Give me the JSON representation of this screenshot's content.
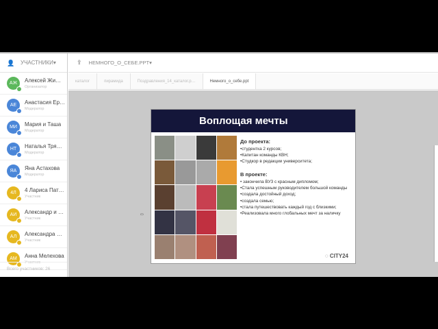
{
  "sidebar": {
    "title": "УЧАСТНИКИ",
    "participants": [
      {
        "initials": "АЖ",
        "name": "Алексей Жи…",
        "role": "Организатор",
        "color": "#5cb85c"
      },
      {
        "initials": "АЕ",
        "name": "Анастасия Ер…",
        "role": "Модератор",
        "color": "#4a86d8"
      },
      {
        "initials": "МИ",
        "name": "Мария и Таша",
        "role": "Модератор",
        "color": "#4a86d8"
      },
      {
        "initials": "НТ",
        "name": "Наталья Тря…",
        "role": "Модератор",
        "color": "#4a86d8"
      },
      {
        "initials": "ЯА",
        "name": "Яна Астахова",
        "role": "Модератор",
        "color": "#4a86d8"
      },
      {
        "initials": "4Л",
        "name": "4 Лариса Пат…",
        "role": "Участник",
        "color": "#e6b820"
      },
      {
        "initials": "АИ",
        "name": "Александр и …",
        "role": "Участник",
        "color": "#e6b820"
      },
      {
        "initials": "АЛ",
        "name": "Александра …",
        "role": "Участник",
        "color": "#e6b820"
      },
      {
        "initials": "АМ",
        "name": "Анна Мелехова",
        "role": "Участник",
        "color": "#e6b820"
      }
    ],
    "footer": "Всего участников: 26"
  },
  "header": {
    "file": "НЕМНОГО_О_СЕБЕ.PPT"
  },
  "tabs": [
    "каталог",
    "пирамида",
    "Поздравления_14_каталог.p…",
    "Немного_о_себе.ppt"
  ],
  "slide": {
    "title": "Воплощая мечты",
    "before_heading": "До проекта:",
    "before": [
      "•студентка 2 курсов;",
      "•Капитан команды КВН;",
      "•Студкор в редакции университета;"
    ],
    "in_heading": "В проекте:",
    "in": [
      "• закончила ВУЗ с красным дипломом;",
      "•Стала успешным руководителем большой команды",
      "•создала достойный доход;",
      "•создала семью;",
      "•стала путешествовать каждый год с близкими;",
      "•Реализовала много глобальных мечт за наличку"
    ],
    "logo": "CITY24"
  }
}
